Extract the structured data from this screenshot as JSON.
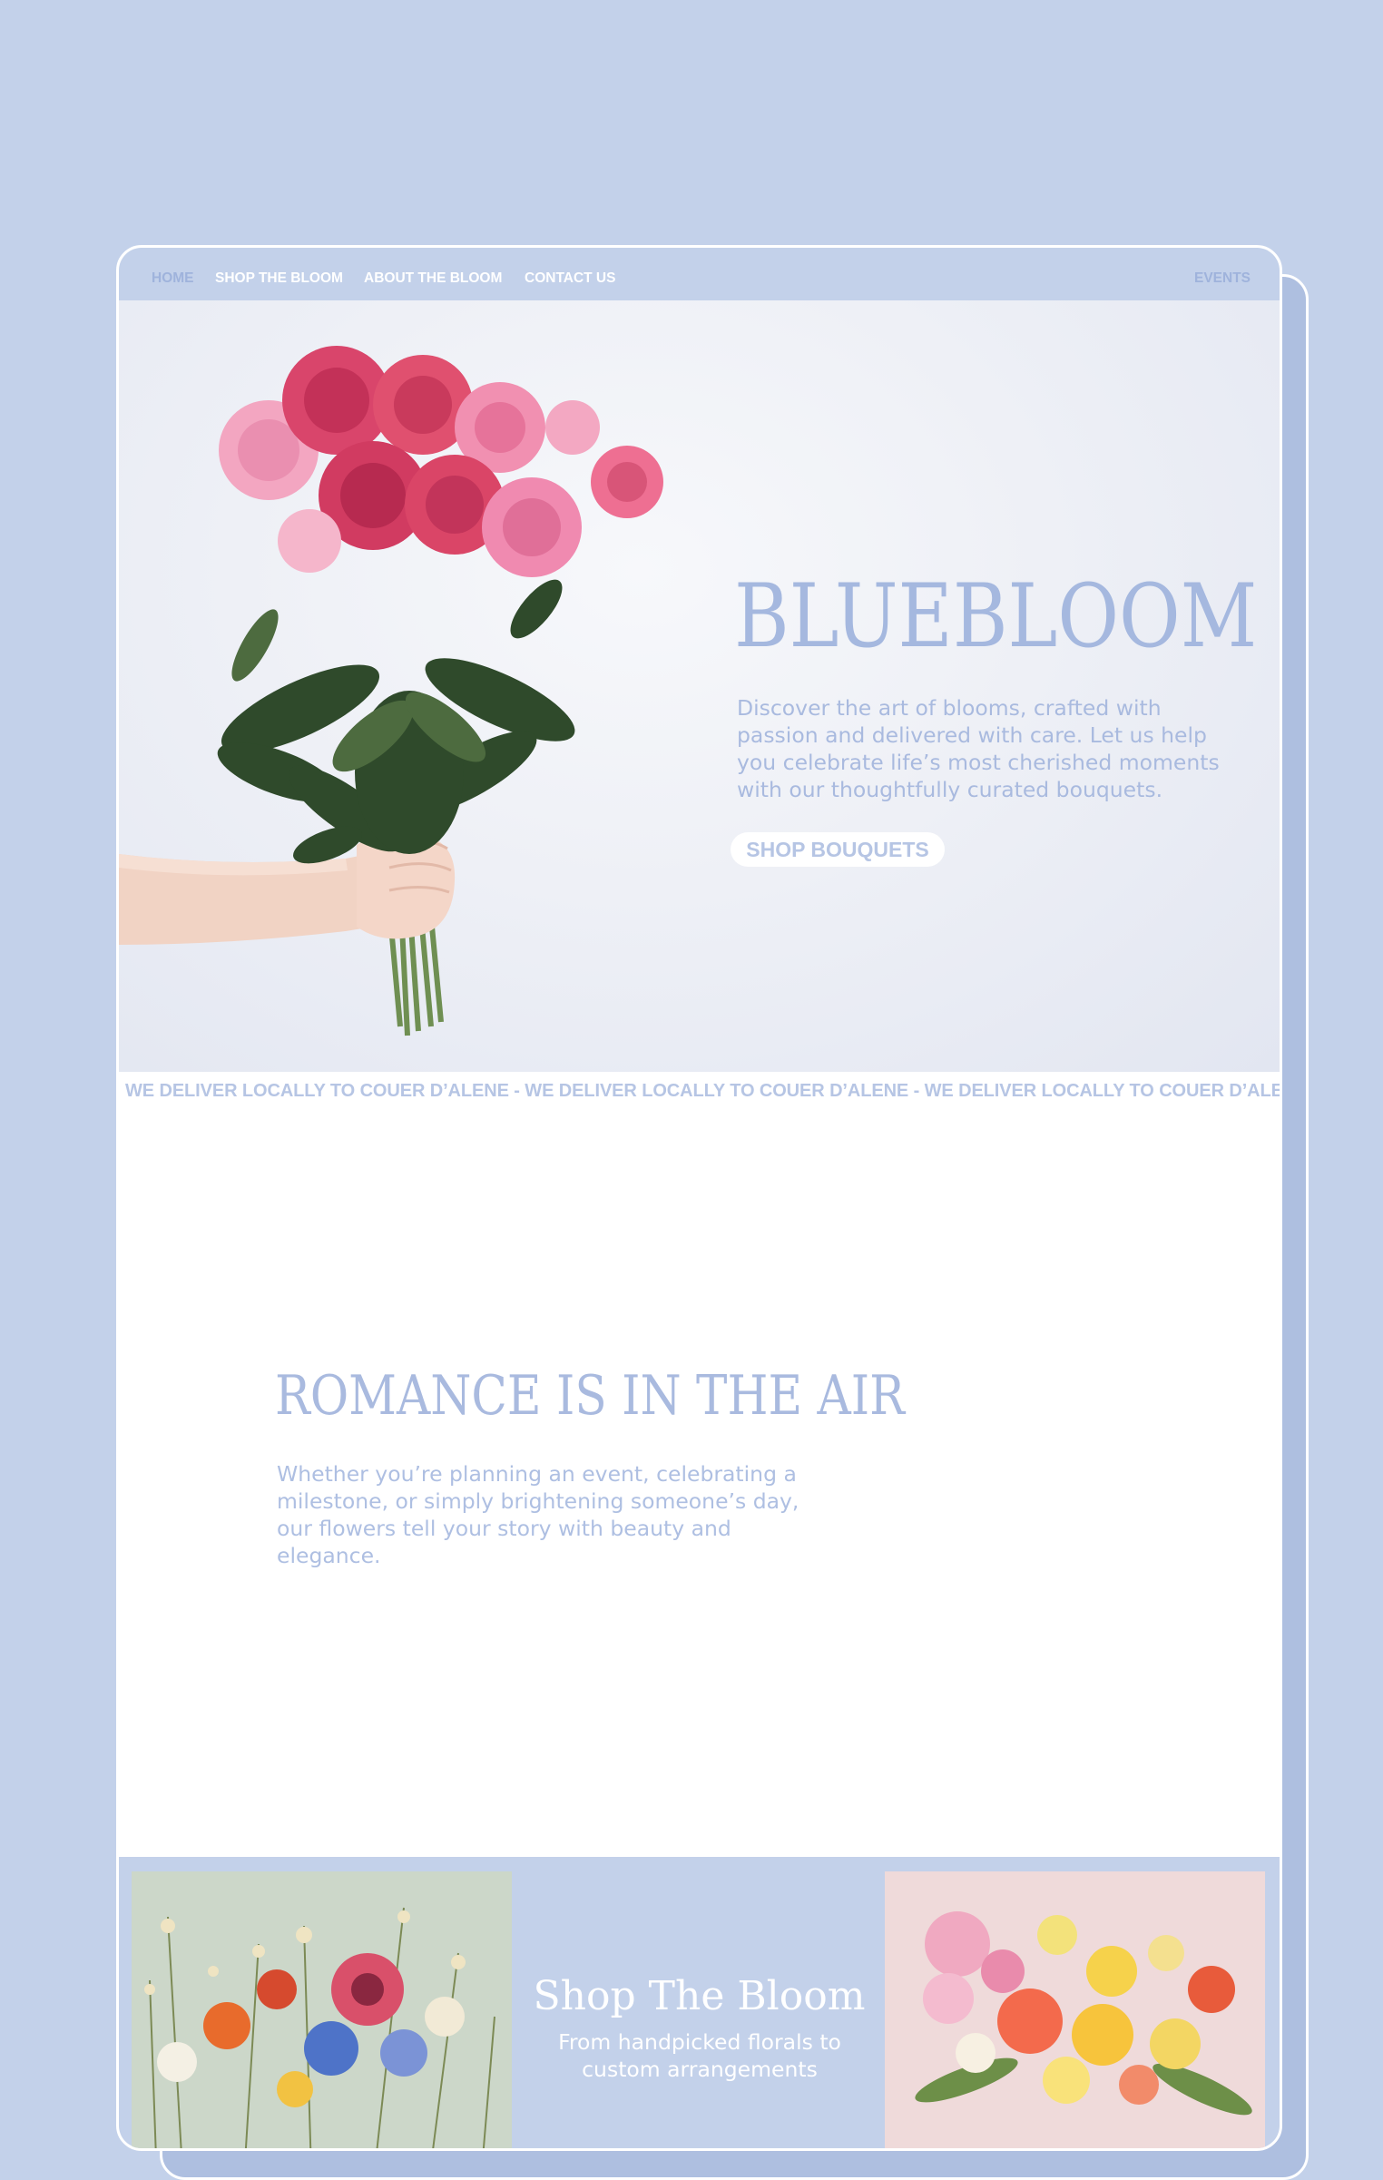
{
  "nav": {
    "home": "HOME",
    "shop": "SHOP THE BLOOM",
    "about": "ABOUT THE BLOOM",
    "contact": "CONTACT US",
    "events": "EVENTS"
  },
  "hero": {
    "title": "BLUEBLOOM",
    "description": "Discover the art of blooms, crafted with passion and delivered with care. Let us help you celebrate life’s most cherished moments with our thoughtfully curated bouquets.",
    "button_label": "SHOP BOUQUETS"
  },
  "marquee": {
    "text": "WE DELIVER LOCALLY TO COUER D’ALENE - WE DELIVER LOCALLY TO COUER D’ALENE - WE DELIVER LOCALLY TO COUER D’ALE"
  },
  "romance": {
    "title": "ROMANCE IS IN THE AIR",
    "description": "Whether you’re planning an event, celebrating a milestone, or simply brightening someone’s day, our flowers tell your story with beauty and elegance."
  },
  "shop": {
    "title": "Shop The Bloom",
    "description": "From handpicked florals to custom arrangements"
  },
  "colors": {
    "background": "#c3d1ea",
    "accent": "#a5b8df",
    "white": "#ffffff"
  }
}
